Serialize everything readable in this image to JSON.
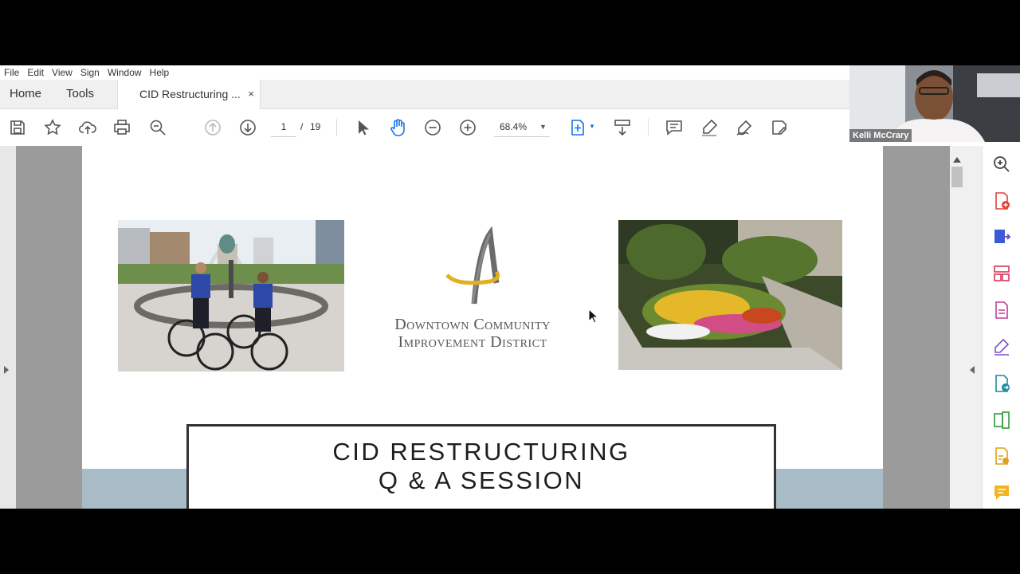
{
  "menu": [
    "File",
    "Edit",
    "View",
    "Sign",
    "Window",
    "Help"
  ],
  "tabs": {
    "home": "Home",
    "tools": "Tools",
    "document": "CID Restructuring ...",
    "close": "×"
  },
  "toolbar": {
    "page_current": "1",
    "page_separator": "/",
    "page_total": "19",
    "zoom": "68.4%",
    "icons": [
      "save-icon",
      "bookmark-star-icon",
      "upload-cloud-icon",
      "print-icon",
      "zoom-search-icon",
      "page-up-icon",
      "page-down-icon",
      "select-arrow-icon",
      "hand-tool-icon",
      "zoom-out-icon",
      "zoom-in-icon",
      "fit-page-icon",
      "scroll-mode-icon",
      "comment-icon",
      "highlight-icon",
      "sign-icon",
      "share-edit-icon"
    ]
  },
  "document": {
    "logo_line1": "Downtown Community",
    "logo_line2": "Improvement District",
    "title_line1": "CID RESTRUCTURING",
    "title_line2": "Q & A SESSION",
    "colors": {
      "band": "#a7bcc6",
      "logo_gold": "#e0b020",
      "logo_gray": "#6b6b6b"
    }
  },
  "side_panel_icons": [
    "search-zoom-icon",
    "create-pdf-icon",
    "export-pdf-icon",
    "organize-pages-icon",
    "edit-pdf-icon",
    "fill-sign-icon",
    "send-review-icon",
    "compress-icon",
    "request-signatures-icon",
    "comment-tool-icon"
  ],
  "video": {
    "participant_name": "Kelli McCrary"
  }
}
